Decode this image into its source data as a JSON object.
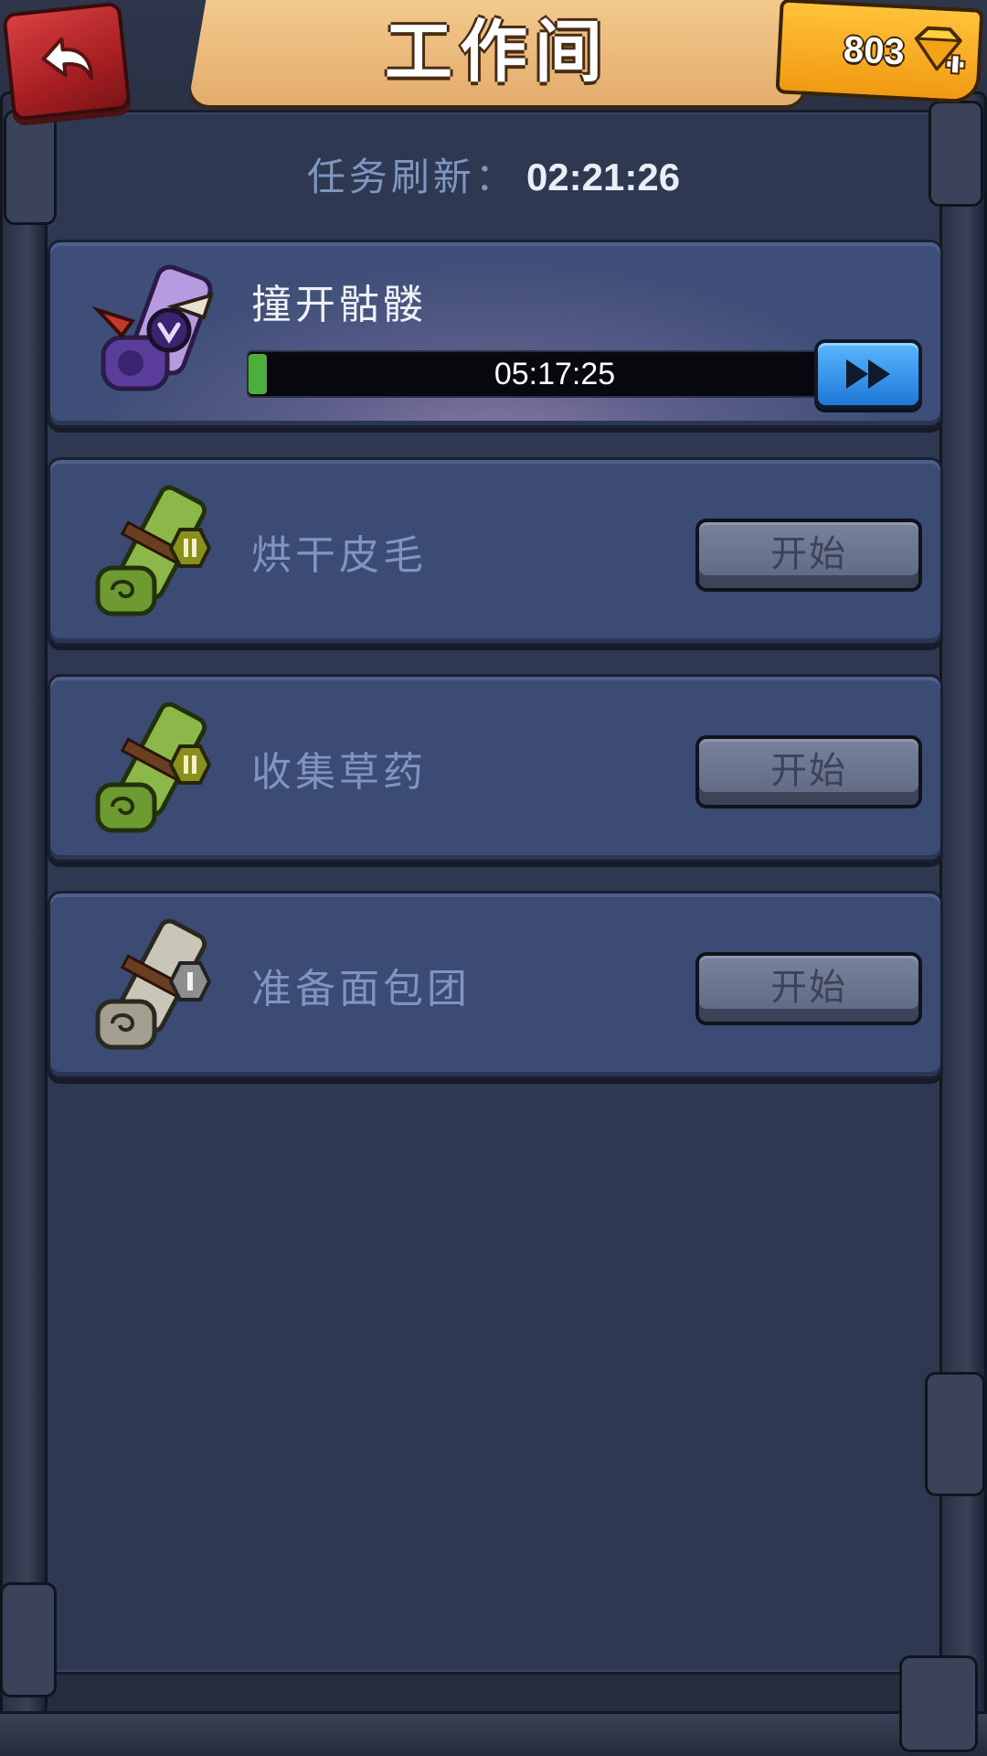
{
  "header": {
    "title": "工作间",
    "back_icon": "back-arrow-icon",
    "gems": "803",
    "gem_icon": "gem-plus-icon"
  },
  "refresh": {
    "label": "任务刷新：",
    "time": "02:21:26"
  },
  "tasks": [
    {
      "name": "撞开骷髅",
      "icon": "purple-skull-scroll-icon",
      "status": "in-progress",
      "timer": "05:17:25",
      "progress_fraction": 0.005,
      "action_icon": "fast-forward-icon"
    },
    {
      "name": "烘干皮毛",
      "icon": "green-scroll-tier-2-icon",
      "tier_badge": "II",
      "status": "available",
      "button_label": "开始"
    },
    {
      "name": "收集草药",
      "icon": "green-scroll-tier-2-icon",
      "tier_badge": "II",
      "status": "available",
      "button_label": "开始"
    },
    {
      "name": "准备面包团",
      "icon": "grey-scroll-tier-1-icon",
      "tier_badge": "I",
      "status": "available",
      "button_label": "开始"
    }
  ],
  "colors": {
    "panel": "#2e3850",
    "card": "#3b4b73",
    "title_banner": "#e3ad6c",
    "gem_box": "#f09a12",
    "back_button": "#a81f22",
    "ff_button": "#1f78d6",
    "progress_fill": "#4cae3c"
  }
}
